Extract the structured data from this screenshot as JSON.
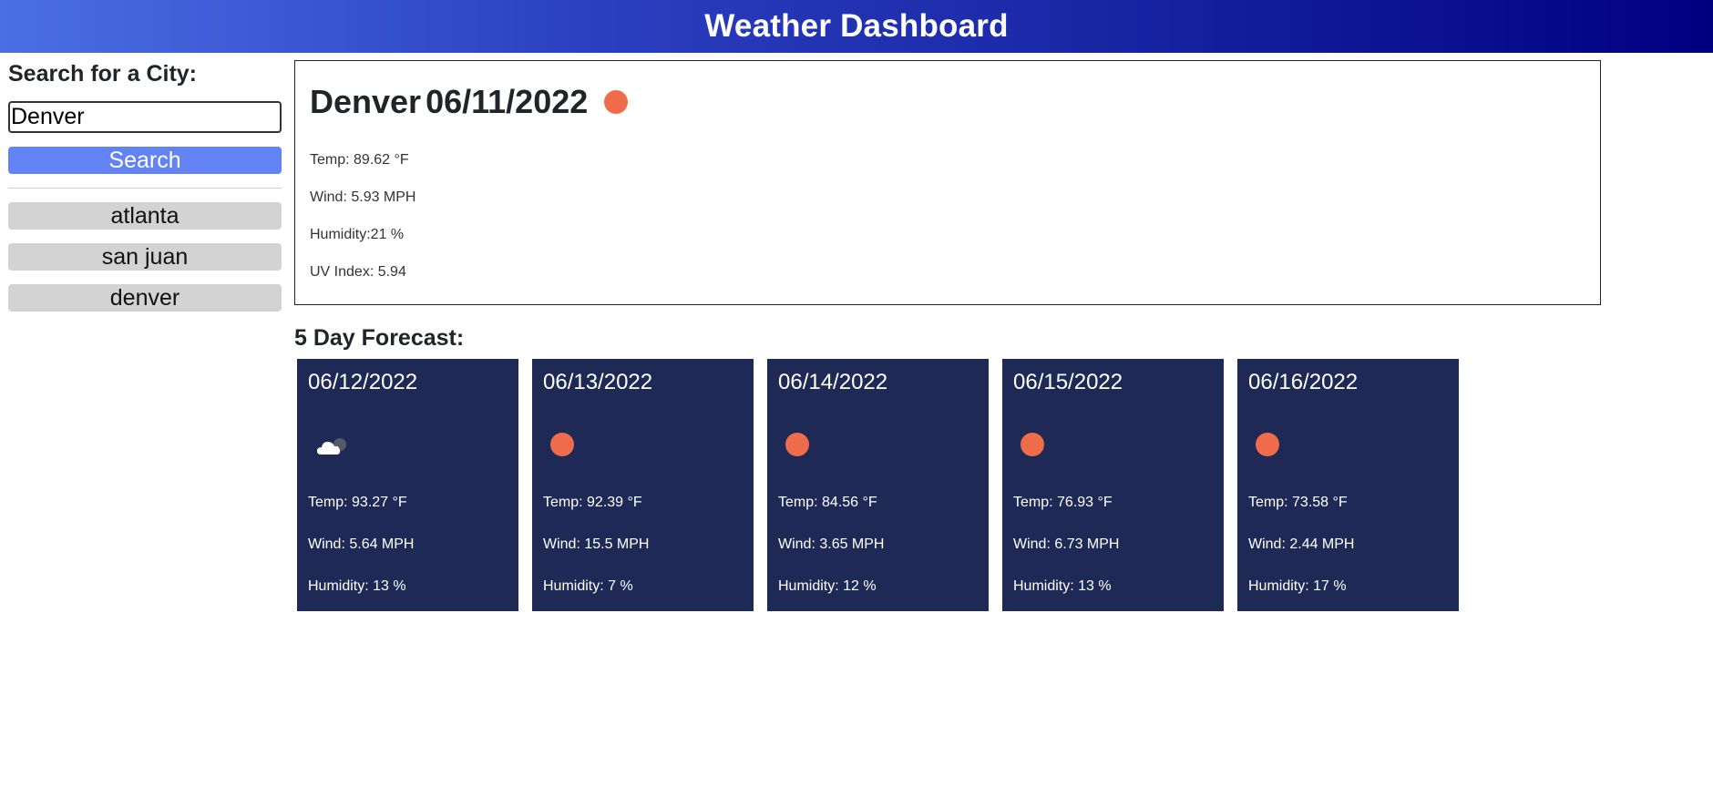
{
  "header": {
    "title": "Weather Dashboard"
  },
  "sidebar": {
    "title": "Search for a City:",
    "search": {
      "value": "Denver",
      "placeholder": ""
    },
    "search_button_label": "Search",
    "history": [
      {
        "label": "atlanta"
      },
      {
        "label": "san juan"
      },
      {
        "label": "denver"
      }
    ]
  },
  "current": {
    "city": "Denver",
    "date": "06/11/2022",
    "icon": "sun-icon",
    "temp": "Temp: 89.62 °F",
    "wind": "Wind: 5.93 MPH",
    "humidity": "Humidity:21 %",
    "uv": "UV Index: 5.94"
  },
  "forecast": {
    "title": "5 Day Forecast:",
    "days": [
      {
        "date": "06/12/2022",
        "icon": "partly-cloudy-icon",
        "temp": "Temp: 93.27 °F",
        "wind": "Wind: 5.64 MPH",
        "humidity": "Humidity: 13 %"
      },
      {
        "date": "06/13/2022",
        "icon": "sun-icon",
        "temp": "Temp: 92.39 °F",
        "wind": "Wind: 15.5 MPH",
        "humidity": "Humidity: 7 %"
      },
      {
        "date": "06/14/2022",
        "icon": "sun-icon",
        "temp": "Temp: 84.56 °F",
        "wind": "Wind: 3.65 MPH",
        "humidity": "Humidity: 12 %"
      },
      {
        "date": "06/15/2022",
        "icon": "sun-icon",
        "temp": "Temp: 76.93 °F",
        "wind": "Wind: 6.73 MPH",
        "humidity": "Humidity: 13 %"
      },
      {
        "date": "06/16/2022",
        "icon": "sun-icon",
        "temp": "Temp: 73.58 °F",
        "wind": "Wind: 2.44 MPH",
        "humidity": "Humidity: 17 %"
      }
    ]
  },
  "colors": {
    "header_gradient_start": "#4a6fe3",
    "header_gradient_end": "#00007f",
    "search_button": "#6383f4",
    "history_button": "#d3d3d3",
    "forecast_card": "#1e2a55",
    "sun": "#ef6c4a"
  }
}
